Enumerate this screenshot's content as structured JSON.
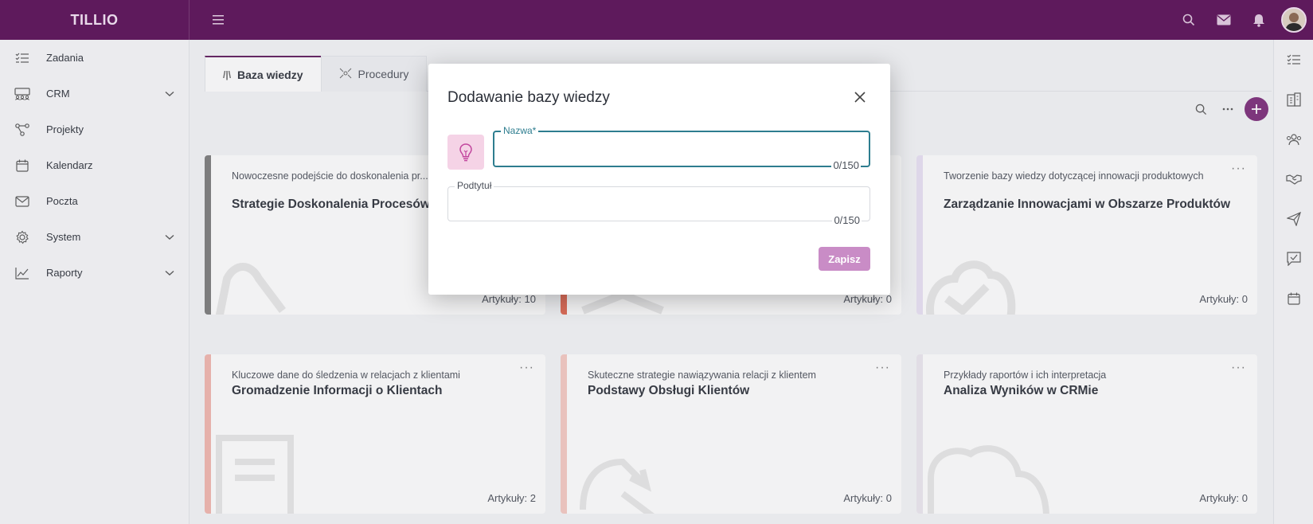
{
  "app": {
    "brand": "TILLIO"
  },
  "sidebar": {
    "items": [
      {
        "label": "Zadania",
        "icon": "tasks-list-icon"
      },
      {
        "label": "CRM",
        "icon": "people-group-icon",
        "expandable": true
      },
      {
        "label": "Projekty",
        "icon": "project-tree-icon"
      },
      {
        "label": "Kalendarz",
        "icon": "calendar-icon"
      },
      {
        "label": "Poczta",
        "icon": "mail-icon"
      },
      {
        "label": "System",
        "icon": "gear-icon",
        "expandable": true
      },
      {
        "label": "Raporty",
        "icon": "chart-line-icon",
        "expandable": true
      }
    ]
  },
  "tabs": [
    {
      "label": "Baza wiedzy",
      "active": true
    },
    {
      "label": "Procedury",
      "active": false
    }
  ],
  "cards": [
    {
      "subtitle": "Nowoczesne podejście do doskonalenia pr... świecie CRM",
      "title": "Strategie Doskonalenia Procesów",
      "count": "Artykuły: 10",
      "color": "#7a7a7a"
    },
    {
      "subtitle": "",
      "title": "",
      "count": "Artykuły: 0",
      "color": "#e0664f"
    },
    {
      "subtitle": "Tworzenie bazy wiedzy dotyczącej innowacji produktowych",
      "title": "Zarządzanie Innowacjami w Obszarze Produktów",
      "count": "Artykuły: 0",
      "color": "#e9e1f4"
    },
    {
      "subtitle": "Kluczowe dane do śledzenia w relacjach z klientami",
      "title": "Gromadzenie Informacji o Klientach",
      "count": "Artykuły: 2",
      "color": "#f2b5ad"
    },
    {
      "subtitle": "Skuteczne strategie nawiązywania relacji z klientem",
      "title": "Podstawy Obsługi Klientów",
      "count": "Artykuły: 0",
      "color": "#f5c9c2"
    },
    {
      "subtitle": "Przykłady raportów i ich interpretacja",
      "title": "Analiza Wyników w CRMie",
      "count": "Artykuły: 0",
      "color": "#ece8f0"
    }
  ],
  "modal": {
    "title": "Dodawanie bazy wiedzy",
    "name_field": {
      "label": "Nazwa*",
      "value": "",
      "counter": "0/150"
    },
    "subtitle_field": {
      "label": "Podtytuł",
      "value": "",
      "counter": "0/150"
    },
    "save_label": "Zapisz"
  },
  "colors": {
    "topbar": "#5e1a5c",
    "accent": "#7a2a78",
    "focus": "#2d7d8f",
    "save_button": "#c98cc6",
    "bulb_bg": "#f5d3e6"
  }
}
